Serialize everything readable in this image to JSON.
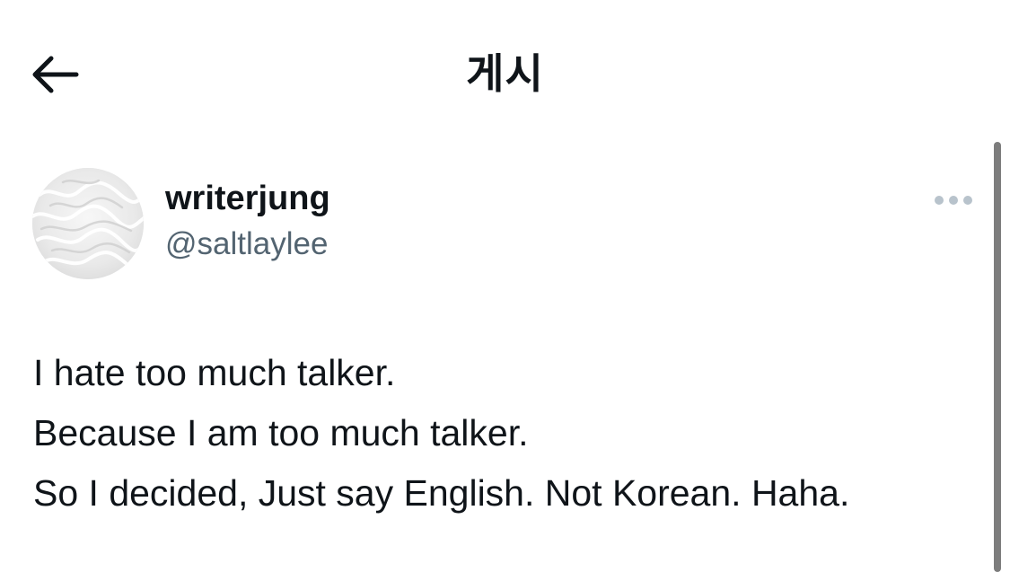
{
  "header": {
    "title": "게시",
    "back_icon": "arrow-left-icon"
  },
  "post": {
    "avatar_icon": "water-ripple-avatar",
    "author": {
      "display_name": "writerjung",
      "handle": "@saltlaylee"
    },
    "more_icon": "more-horizontal-icon",
    "text_lines": [
      "I hate too much talker.",
      "Because I am too much talker.",
      "So I decided, Just say English. Not Korean. Haha."
    ]
  },
  "colors": {
    "text_primary": "#0f1419",
    "text_secondary": "#536471",
    "more_dots": "#b8c3cc",
    "scrollbar": "#7d7d7d"
  }
}
